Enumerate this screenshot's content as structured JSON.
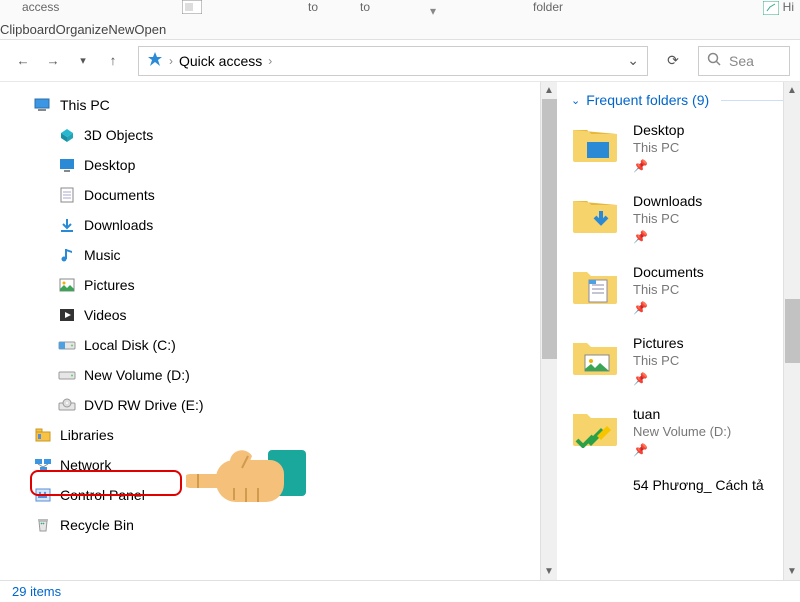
{
  "ribbon": {
    "fragments": {
      "access": "access",
      "to1": "to",
      "to2": "to",
      "folder": "folder",
      "hi": "Hi"
    },
    "groups": [
      "Clipboard",
      "Organize",
      "New",
      "Open"
    ]
  },
  "nav": {
    "breadcrumb_root": "Quick access",
    "search_placeholder": "Sea"
  },
  "tree": {
    "root": "This PC",
    "children": [
      "3D Objects",
      "Desktop",
      "Documents",
      "Downloads",
      "Music",
      "Pictures",
      "Videos",
      "Local Disk (C:)",
      "New Volume (D:)",
      "DVD RW Drive (E:)"
    ],
    "siblings": [
      "Libraries",
      "Network",
      "Control Panel",
      "Recycle Bin"
    ]
  },
  "section": {
    "title": "Frequent folders (9)"
  },
  "folders": [
    {
      "name": "Desktop",
      "sub": "This PC",
      "pinned": true
    },
    {
      "name": "Downloads",
      "sub": "This PC",
      "pinned": true
    },
    {
      "name": "Documents",
      "sub": "This PC",
      "pinned": true
    },
    {
      "name": "Pictures",
      "sub": "This PC",
      "pinned": true
    },
    {
      "name": "tuan",
      "sub": "New Volume (D:)",
      "pinned": true
    },
    {
      "name": "54 Phương_ Cách tả",
      "sub": "",
      "pinned": false
    }
  ],
  "status": {
    "count": "29 items"
  },
  "pin_glyph": "📌"
}
